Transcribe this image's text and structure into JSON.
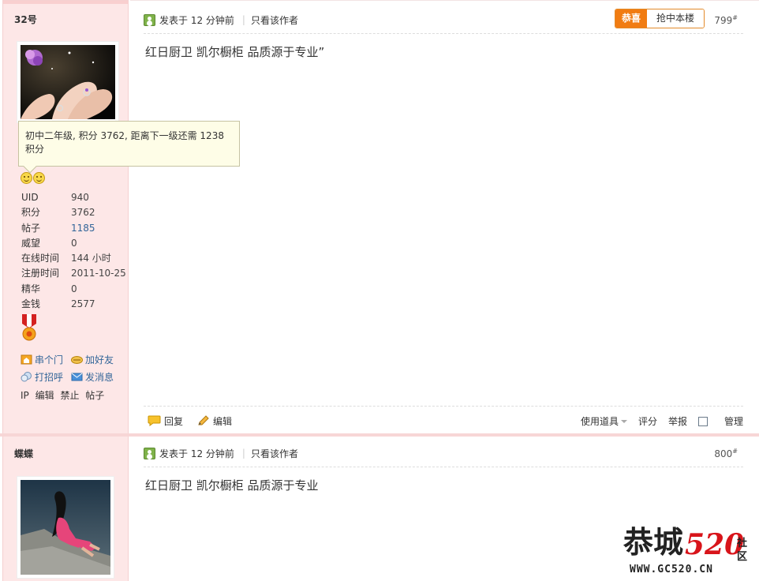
{
  "post1": {
    "username": "32号",
    "tooltip": "初中二年级, 积分 3762, 距离下一级还需 1238 积分",
    "stats": [
      {
        "label": "UID",
        "value": "940",
        "link": false
      },
      {
        "label": "积分",
        "value": "3762",
        "link": false
      },
      {
        "label": "帖子",
        "value": "1185",
        "link": true
      },
      {
        "label": "威望",
        "value": "0",
        "link": false
      },
      {
        "label": "在线时间",
        "value": "144 小时",
        "link": false
      },
      {
        "label": "注册时间",
        "value": "2011-10-25",
        "link": false
      },
      {
        "label": "精华",
        "value": "0",
        "link": false
      },
      {
        "label": "金钱",
        "value": "2577",
        "link": false
      }
    ],
    "actions": {
      "visit": "串个门",
      "add_friend": "加好友",
      "greet": "打招呼",
      "message": "发消息"
    },
    "admin_links": [
      "IP",
      "编辑",
      "禁止",
      "帖子"
    ],
    "posted": "发表于 12 分钟前",
    "only_author": "只看该作者",
    "gift_label": "恭喜",
    "gift_action": "抢中本楼",
    "floor": "799",
    "floor_mark": "#",
    "content": "红日厨卫 凯尔橱柜 品质源于专业”",
    "bar": {
      "reply": "回复",
      "edit": "编辑",
      "tools": "使用道具",
      "rate": "评分",
      "report": "举报",
      "manage": "管理"
    }
  },
  "post2": {
    "username": "蝶蝶",
    "posted": "发表于 12 分钟前",
    "only_author": "只看该作者",
    "floor": "800",
    "floor_mark": "#",
    "content": "红日厨卫 凯尔橱柜 品质源于专业"
  },
  "logo": {
    "text_cn": "恭城",
    "text_num": "520",
    "text_side1": "社",
    "text_side2": "区",
    "url": "WWW.GC520.CN"
  },
  "colors": {
    "sidebar_bg": "#fde7e7",
    "link": "#336699",
    "gift_orange": "#f17c12",
    "logo_red": "#d8141a"
  }
}
